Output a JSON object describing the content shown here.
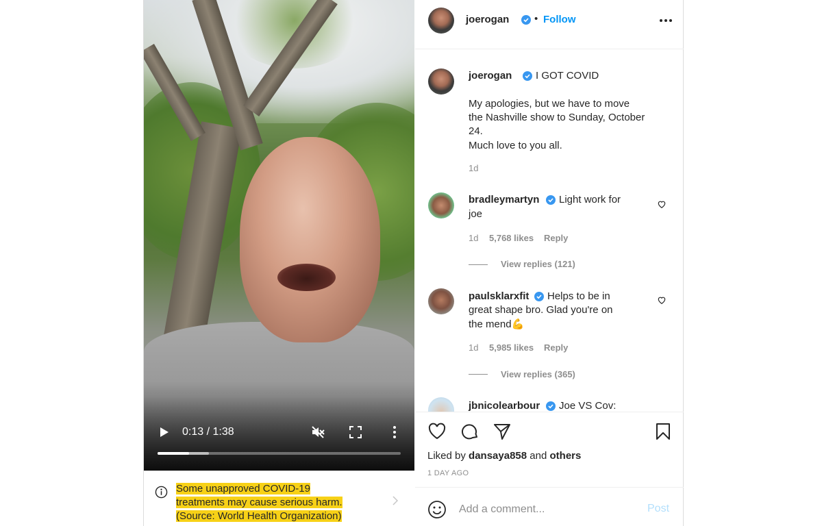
{
  "video": {
    "time_display": "0:13 / 1:38",
    "played_fraction": 0.13,
    "buffered_fraction": 0.21
  },
  "warning": {
    "line1": "Some unapproved COVID-19",
    "line2": "treatments may cause serious harm.",
    "line3": "(Source: World Health Organization)"
  },
  "header": {
    "username": "joerogan",
    "separator": "•",
    "follow_label": "Follow"
  },
  "caption": {
    "username": "joerogan",
    "title": "I GOT COVID",
    "body_line1": "My apologies, but we have to move",
    "body_line2": "the Nashville show to Sunday, October",
    "body_line3": "24.",
    "body_line4": "Much love to you all.",
    "time": "1d"
  },
  "comments": [
    {
      "username": "bradleymartyn",
      "text_line1": "Light work for",
      "text_line2": "joe",
      "time": "1d",
      "likes": "5,768 likes",
      "reply_label": "Reply",
      "view_replies": "View replies (121)"
    },
    {
      "username": "paulsklarxfit",
      "text_line1": "Helps to be in",
      "text_line2": "great shape bro. Glad you're on",
      "text_line3": "the mend",
      "emoji": "💪",
      "time": "1d",
      "likes": "5,985 likes",
      "reply_label": "Reply",
      "view_replies": "View replies (365)"
    },
    {
      "username": "jbnicolearbour",
      "text_line1": "Joe VS Cov:"
    }
  ],
  "footer": {
    "liked_prefix": "Liked by",
    "liked_user": "dansaya858",
    "liked_and": "and",
    "liked_others": "others",
    "date": "1 DAY AGO",
    "add_comment_placeholder": "Add a comment...",
    "post_label": "Post"
  },
  "colors": {
    "accent": "#0095f6",
    "verified": "#3897f0",
    "warning_highlight": "#f7d117",
    "muted": "#8e8e8e"
  },
  "icons": {
    "video": [
      "play-icon",
      "muted-speaker-icon",
      "fullscreen-icon",
      "more-vertical-icon"
    ],
    "actions": [
      "heart-icon",
      "comment-icon",
      "share-icon",
      "bookmark-icon"
    ],
    "misc": [
      "info-icon",
      "chevron-right-icon",
      "emoji-icon",
      "more-horizontal-icon",
      "verified-badge-icon"
    ]
  }
}
